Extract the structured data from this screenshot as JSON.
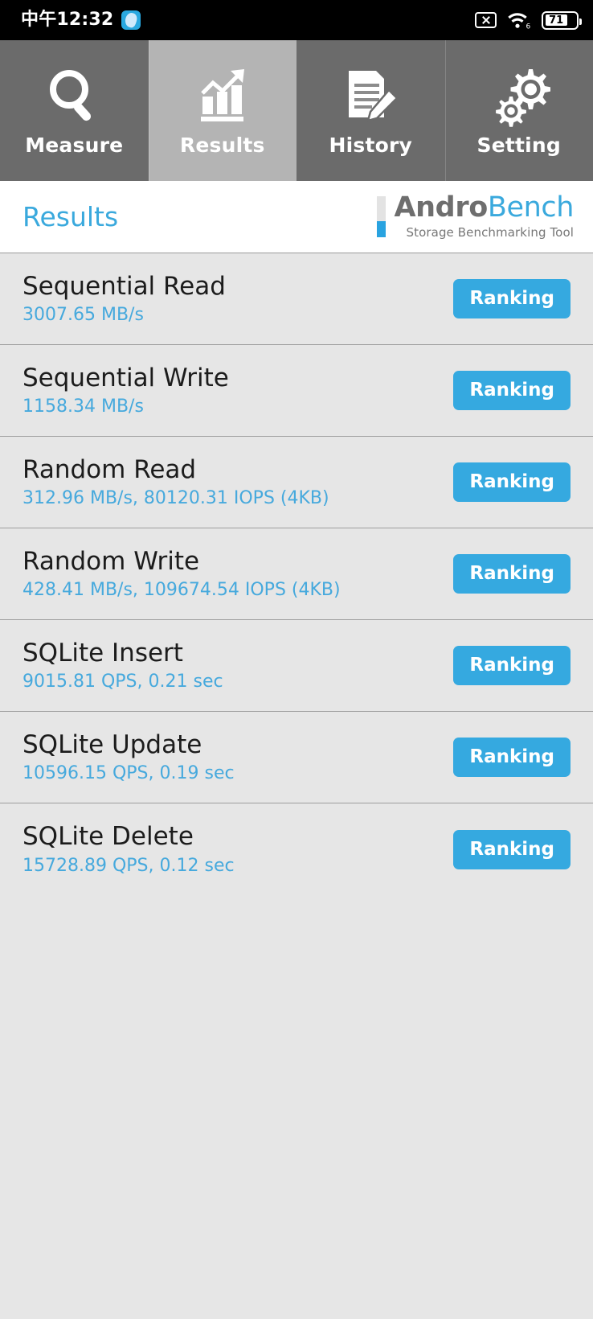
{
  "statusbar": {
    "time": "中午12:32",
    "app_badge_icon": "app-badge-icon",
    "no_sim_icon": "no-sim-icon",
    "wifi_icon": "wifi-6-icon",
    "wifi_generation": "6",
    "battery_icon": "battery-icon",
    "battery_level": "71"
  },
  "tabs": [
    {
      "label": "Measure",
      "icon": "magnifier-icon",
      "active": false
    },
    {
      "label": "Results",
      "icon": "bar-chart-icon",
      "active": true
    },
    {
      "label": "History",
      "icon": "document-pencil-icon",
      "active": false
    },
    {
      "label": "Setting",
      "icon": "gears-icon",
      "active": false
    }
  ],
  "header": {
    "title": "Results",
    "logo_primary": "Andro",
    "logo_secondary": "Bench",
    "logo_tagline": "Storage Benchmarking Tool"
  },
  "results": [
    {
      "title": "Sequential Read",
      "value": "3007.65 MB/s",
      "button": "Ranking"
    },
    {
      "title": "Sequential Write",
      "value": "1158.34 MB/s",
      "button": "Ranking"
    },
    {
      "title": "Random Read",
      "value": "312.96 MB/s, 80120.31 IOPS (4KB)",
      "button": "Ranking"
    },
    {
      "title": "Random Write",
      "value": "428.41 MB/s, 109674.54 IOPS (4KB)",
      "button": "Ranking"
    },
    {
      "title": "SQLite Insert",
      "value": "9015.81 QPS, 0.21 sec",
      "button": "Ranking"
    },
    {
      "title": "SQLite Update",
      "value": "10596.15 QPS, 0.19 sec",
      "button": "Ranking"
    },
    {
      "title": "SQLite Delete",
      "value": "15728.89 QPS, 0.12 sec",
      "button": "Ranking"
    }
  ],
  "colors": {
    "accent_blue": "#35a9e0",
    "value_blue": "#46a9dd",
    "tab_inactive": "#6b6b6b",
    "tab_active": "#b4b4b4",
    "list_bg": "#e6e6e6",
    "statusbar_bg": "#000000"
  }
}
